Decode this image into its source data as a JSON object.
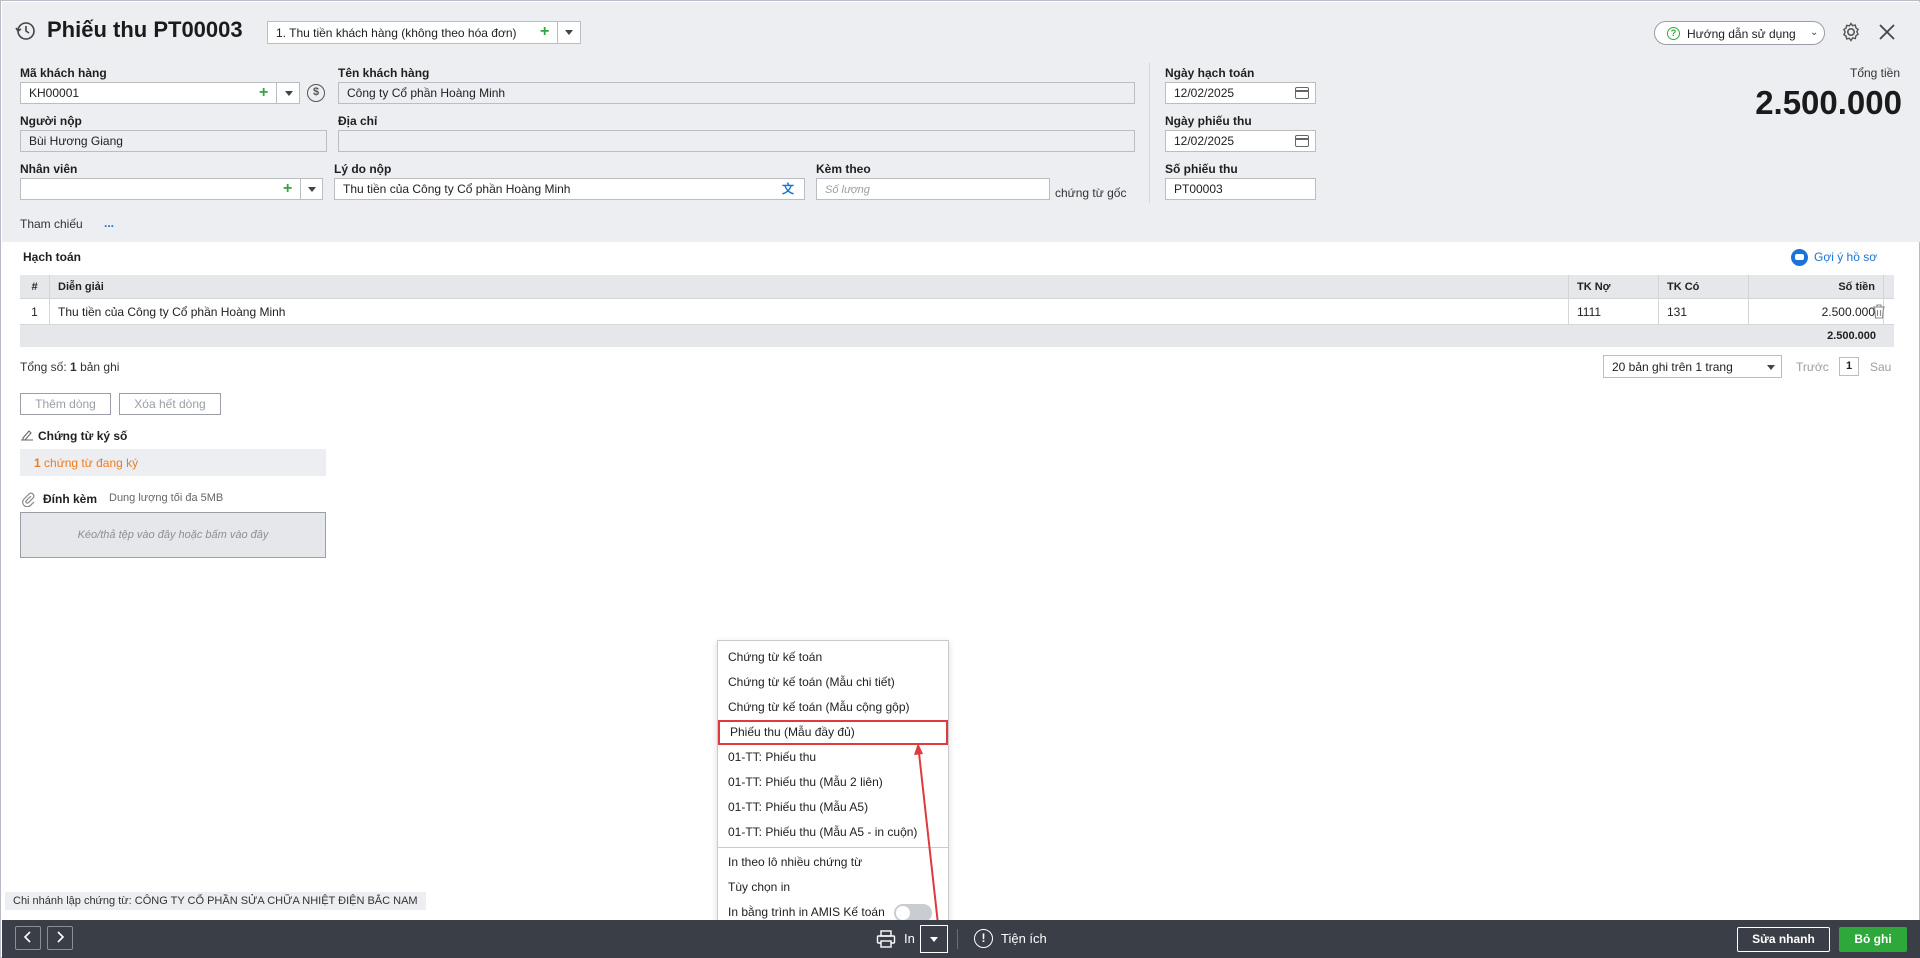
{
  "header": {
    "title": "Phiếu thu PT00003",
    "type_select": "1. Thu tiền khách hàng (không theo hóa đơn)",
    "help_button": "Hướng dẫn sử dụng"
  },
  "form": {
    "ma_khach_hang": {
      "label": "Mã khách hàng",
      "value": "KH00001"
    },
    "ten_khach_hang": {
      "label": "Tên khách hàng",
      "value": "Công ty Cổ phần Hoàng Minh"
    },
    "nguoi_nop": {
      "label": "Người nộp",
      "value": "Bùi Hương Giang"
    },
    "dia_chi": {
      "label": "Địa chỉ",
      "value": ""
    },
    "nhan_vien": {
      "label": "Nhân viên",
      "value": ""
    },
    "ly_do_nop": {
      "label": "Lý do nộp",
      "value": "Thu tiền của Công ty Cổ phần Hoàng Minh"
    },
    "kem_theo": {
      "label": "Kèm theo",
      "placeholder": "Số lượng",
      "suffix": "chứng từ gốc"
    },
    "ngay_hach_toan": {
      "label": "Ngày hạch toán",
      "value": "12/02/2025"
    },
    "ngay_phieu_thu": {
      "label": "Ngày phiếu thu",
      "value": "12/02/2025"
    },
    "so_phieu_thu": {
      "label": "Số phiếu thu",
      "value": "PT00003"
    },
    "tham_chieu": {
      "label": "Tham chiếu",
      "value": "..."
    },
    "tong_tien": {
      "label": "Tổng tiền",
      "value": "2.500.000"
    }
  },
  "hach_toan": {
    "title": "Hạch toán",
    "suggest_link": "Gợi ý hồ sơ",
    "columns": [
      "#",
      "Diễn giải",
      "TK Nợ",
      "TK Có",
      "Số tiền"
    ],
    "rows": [
      {
        "no": "1",
        "dien_giai": "Thu tiền của Công ty Cổ phần Hoàng Minh",
        "tk_no": "1111",
        "tk_co": "131",
        "so_tien": "2.500.000"
      }
    ],
    "total": "2.500.000",
    "summary_prefix": "Tổng số:",
    "summary_count": "1",
    "summary_suffix": "bản ghi",
    "page_size": "20 bản ghi trên 1 trang",
    "prev": "Trước",
    "page": "1",
    "next": "Sau",
    "add_row": "Thêm dòng",
    "delete_rows": "Xóa hết dòng"
  },
  "chung_tu_ky_so": {
    "title": "Chứng từ ký số",
    "count": "1",
    "text": "chứng từ đang ký"
  },
  "dinh_kem": {
    "title": "Đính kèm",
    "limit": "Dung lượng tối đa 5MB",
    "dropzone": "Kéo/thả tệp vào đây hoặc bấm vào đây"
  },
  "print_menu": {
    "items": [
      "Chứng từ kế toán",
      "Chứng từ kế toán (Mẫu chi tiết)",
      "Chứng từ kế toán (Mẫu cộng gộp)",
      "Phiếu thu (Mẫu đầy đủ)",
      "01-TT: Phiếu thu",
      "01-TT: Phiếu thu (Mẫu 2 liên)",
      "01-TT: Phiếu thu (Mẫu A5)",
      "01-TT: Phiếu thu (Mẫu A5 - in cuộn)"
    ],
    "extra": [
      "In theo lô nhiều chứng từ",
      "Tùy chọn in",
      "In bằng trình in AMIS Kế toán"
    ],
    "highlighted_index": 3,
    "highlight_color": "#e0393e"
  },
  "branch_note": "Chi nhánh lập chứng từ: CÔNG TY CỔ PHẦN SỬA CHỮA NHIỆT ĐIỆN BẮC NAM",
  "bottom_bar": {
    "print_label": "In",
    "utilities_label": "Tiện ích",
    "quick_edit": "Sửa nhanh",
    "discard": "Bỏ ghi"
  },
  "colors": {
    "accent_green": "#2fa83b",
    "orange": "#f07c1c",
    "bar_dark": "#3a3f47",
    "link_blue": "#1a73d9"
  }
}
